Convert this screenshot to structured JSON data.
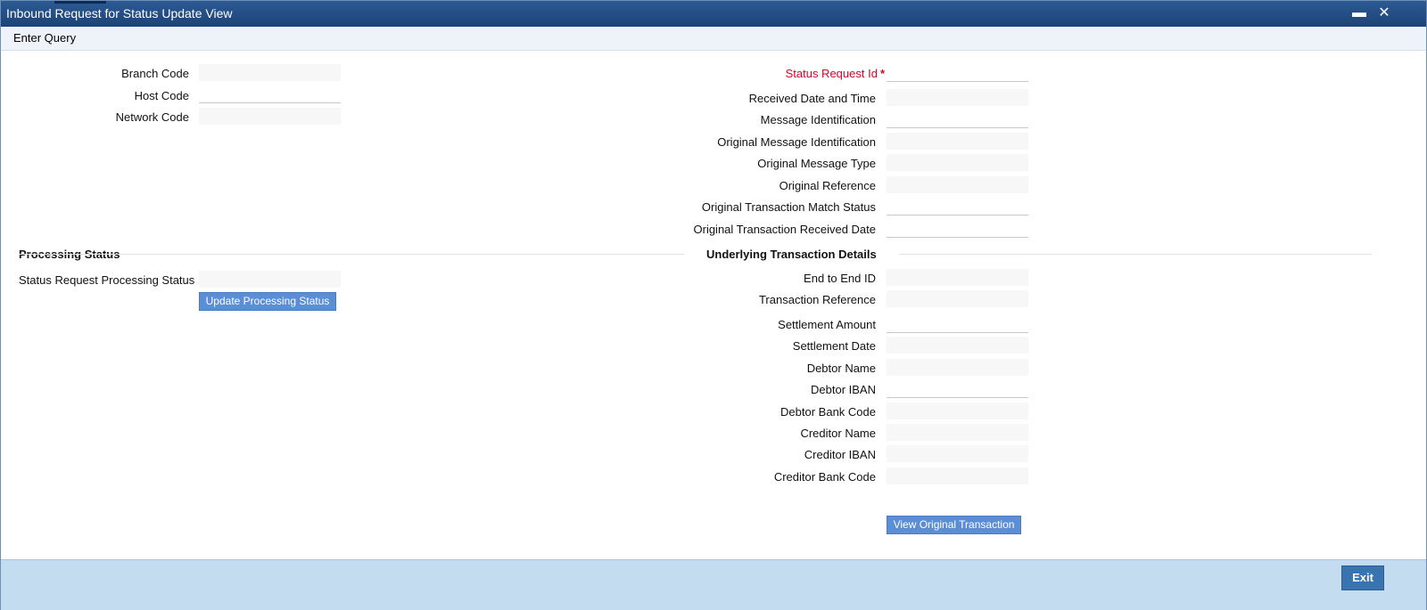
{
  "window": {
    "title": "Inbound Request for Status Update View",
    "minimize_glyph": "▬",
    "close_glyph": "✕"
  },
  "menu": {
    "enter_query": "Enter Query"
  },
  "left_fields": {
    "branch_code": {
      "label": "Branch Code",
      "value": ""
    },
    "host_code": {
      "label": "Host Code",
      "value": ""
    },
    "network_code": {
      "label": "Network Code",
      "value": ""
    }
  },
  "right_fields": {
    "status_request_id": {
      "label": "Status Request Id",
      "required_mark": "*",
      "value": ""
    },
    "received_date_time": {
      "label": "Received Date and Time",
      "value": ""
    },
    "message_identification": {
      "label": "Message Identification",
      "value": ""
    },
    "original_message_identification": {
      "label": "Original Message Identification",
      "value": ""
    },
    "original_message_type": {
      "label": "Original Message Type",
      "value": ""
    },
    "original_reference": {
      "label": "Original Reference",
      "value": ""
    },
    "original_transaction_match_status": {
      "label": "Original Transaction Match Status",
      "value": ""
    },
    "original_transaction_received_date": {
      "label": "Original Transaction Received Date",
      "value": ""
    }
  },
  "processing_status": {
    "title": "Processing Status",
    "status_label": "Status Request Processing Status",
    "status_value": "",
    "update_button": "Update Processing Status"
  },
  "underlying": {
    "title": "Underlying Transaction Details",
    "end_to_end_id": {
      "label": "End to End ID",
      "value": ""
    },
    "transaction_reference": {
      "label": "Transaction Reference",
      "value": ""
    },
    "settlement_amount": {
      "label": "Settlement Amount",
      "value": ""
    },
    "settlement_date": {
      "label": "Settlement Date",
      "value": ""
    },
    "debtor_name": {
      "label": "Debtor Name",
      "value": ""
    },
    "debtor_iban": {
      "label": "Debtor IBAN",
      "value": ""
    },
    "debtor_bank_code": {
      "label": "Debtor Bank Code",
      "value": ""
    },
    "creditor_name": {
      "label": "Creditor Name",
      "value": ""
    },
    "creditor_iban": {
      "label": "Creditor IBAN",
      "value": ""
    },
    "creditor_bank_code": {
      "label": "Creditor Bank Code",
      "value": ""
    },
    "view_original_button": "View Original Transaction"
  },
  "footer": {
    "exit_button": "Exit"
  }
}
